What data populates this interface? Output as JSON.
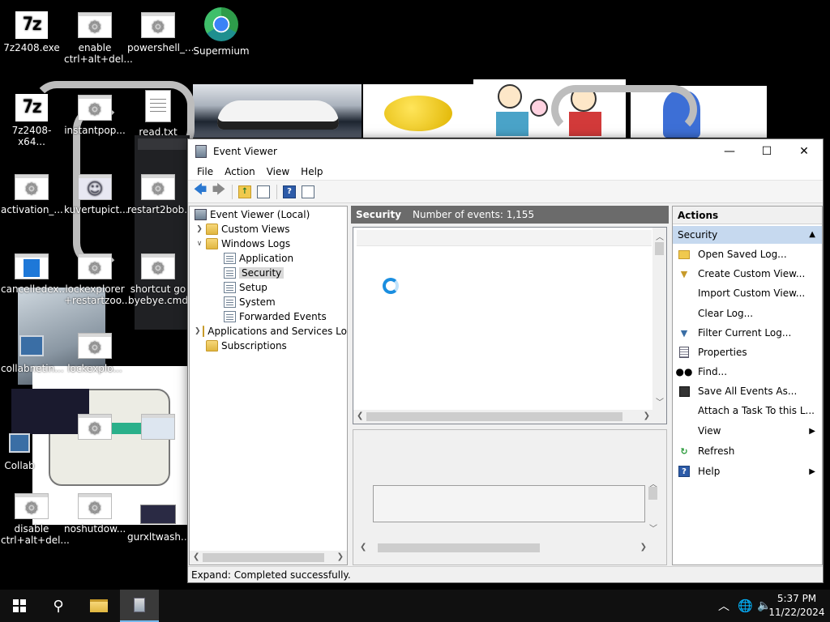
{
  "desktop": {
    "icons": [
      {
        "label": "7z2408.exe"
      },
      {
        "label": "enable ctrl+alt+del..."
      },
      {
        "label": "powershell_..."
      },
      {
        "label": "Supermium"
      },
      {
        "label": "7z2408-x64..."
      },
      {
        "label": "instantpop..."
      },
      {
        "label": "read.txt"
      },
      {
        "label": "activation_..."
      },
      {
        "label": "kuvertupict..."
      },
      {
        "label": "restart2bob..."
      },
      {
        "label": "cancelledex..."
      },
      {
        "label": "lockexplorer +restartzoo..."
      },
      {
        "label": "shortcut go byebye.cmd"
      },
      {
        "label": "collabnetin..."
      },
      {
        "label": "lockexplo..."
      },
      {
        "label": "Collab"
      },
      {
        "label": "disable ctrl+alt+del..."
      },
      {
        "label": "noshutdow..."
      },
      {
        "label": "gurxltwash..."
      }
    ]
  },
  "window": {
    "title": "Event Viewer",
    "controls": {
      "minimize": "—",
      "maximize": "☐",
      "close": "✕"
    },
    "menu": [
      "File",
      "Action",
      "View",
      "Help"
    ],
    "tree": {
      "root": "Event Viewer (Local)",
      "custom_views": "Custom Views",
      "windows_logs": "Windows Logs",
      "logs": [
        "Application",
        "Security",
        "Setup",
        "System",
        "Forwarded Events"
      ],
      "apps_services": "Applications and Services Lo",
      "subscriptions": "Subscriptions",
      "selected": "Security"
    },
    "center": {
      "log_name": "Security",
      "event_count_label": "Number of events: 1,155"
    },
    "actions": {
      "header": "Actions",
      "section": "Security",
      "items": [
        {
          "label": "Open Saved Log...",
          "icon": "folder-open-icon"
        },
        {
          "label": "Create Custom View...",
          "icon": "funnel-icon"
        },
        {
          "label": "Import Custom View...",
          "icon": "blank"
        },
        {
          "label": "Clear Log...",
          "icon": "blank"
        },
        {
          "label": "Filter Current Log...",
          "icon": "funnel-icon"
        },
        {
          "label": "Properties",
          "icon": "properties-icon"
        },
        {
          "label": "Find...",
          "icon": "binoculars-icon"
        },
        {
          "label": "Save All Events As...",
          "icon": "save-icon"
        },
        {
          "label": "Attach a Task To this L...",
          "icon": "blank"
        },
        {
          "label": "View",
          "icon": "blank",
          "submenu": true
        },
        {
          "label": "Refresh",
          "icon": "refresh-icon"
        },
        {
          "label": "Help",
          "icon": "help-icon",
          "submenu": true
        }
      ]
    },
    "status": "Expand:  Completed successfully."
  },
  "taskbar": {
    "time": "5:37 PM",
    "date": "11/22/2024"
  },
  "colors": {
    "accent_selection": "#c6d9ef",
    "header_gray": "#6b6b6b",
    "spinner_blue": "#1a8ee0"
  }
}
